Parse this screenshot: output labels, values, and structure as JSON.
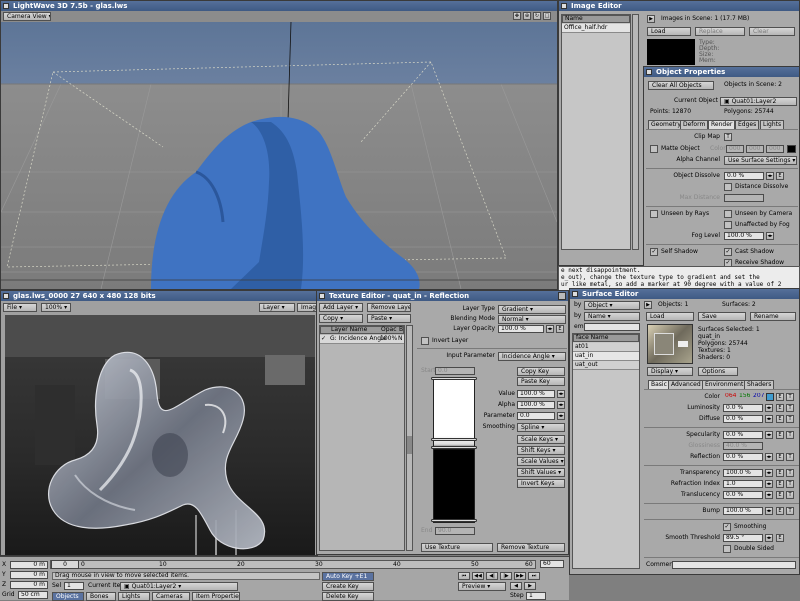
{
  "viewport": {
    "title": "LightWave 3D 7.5b - glas.lws",
    "view_mode": "Camera View"
  },
  "image_editor": {
    "title": "Image Editor",
    "list_header": "Name",
    "items": [
      "Office_half.hdr"
    ],
    "images_in_scene": "Images in Scene: 1 (17.7 MB)",
    "load": "Load",
    "replace": "Replace",
    "clear": "Clear",
    "info": [
      "Type:",
      "Depth:",
      "Size:",
      "Mem:"
    ]
  },
  "object_properties": {
    "title": "Object Properties",
    "clear_all": "Clear All Objects",
    "objects_in_scene": "Objects in Scene: 2",
    "current_object_label": "Current Object",
    "current_object": "Quat01:Layer2",
    "points": "Points: 12870",
    "polygons": "Polygons: 25744",
    "tabs": [
      "Geometry",
      "Deform",
      "Render",
      "Edges",
      "Lights"
    ],
    "clip_map": "Clip Map",
    "matte_object": "Matte Object",
    "color_label": "Color",
    "color_values": [
      "000",
      "000",
      "000"
    ],
    "alpha_channel_label": "Alpha Channel",
    "alpha_channel": "Use Surface Settings",
    "object_dissolve_label": "Object Dissolve",
    "object_dissolve": "0.0 %",
    "distance_dissolve": "Distance Dissolve",
    "max_distance_label": "Max Distance",
    "unseen_by_rays": "Unseen by Rays",
    "unseen_by_camera": "Unseen by Camera",
    "unaffected_by_fog": "Unaffected by Fog",
    "fog_level_label": "Fog Level",
    "fog_level": "100.0 %",
    "self_shadow": "Self Shadow",
    "cast_shadow": "Cast Shadow",
    "receive_shadow": "Receive Shadow"
  },
  "message": {
    "lines": [
      "e next disappointment.",
      "e_out), change the texture type to gradient and set the",
      "ur like metal, so add a marker at 90 degree with a value of 2"
    ]
  },
  "render": {
    "title": "glas.lws_0000 27  640 x 480 128 bits",
    "file": "File",
    "zoom": "100%",
    "layer": "Layer",
    "image": "Image"
  },
  "texture_editor": {
    "title": "Texture Editor - quat_in - Reflection",
    "add_layer": "Add Layer",
    "remove_layer": "Remove Layer",
    "copy": "Copy",
    "paste": "Paste",
    "col_layer_name": "Layer Name",
    "col_opac": "Opac",
    "col_b": "B",
    "row_name": "G: Incidence Angle",
    "row_opac": "100%",
    "row_b": "N",
    "layer_type_label": "Layer Type",
    "layer_type": "Gradient",
    "blending_mode_label": "Blending Mode",
    "blending_mode": "Normal",
    "layer_opacity_label": "Layer Opacity",
    "layer_opacity": "100.0 %",
    "invert_layer": "Invert Layer",
    "input_parameter_label": "Input Parameter",
    "input_parameter": "Incidence Angle",
    "start_label": "Start",
    "start_value": "0.0",
    "end_label": "End",
    "end_value": "90.0",
    "copy_key": "Copy Key",
    "paste_key": "Paste Key",
    "value_label": "Value",
    "value": "100.0 %",
    "alpha_label": "Alpha",
    "alpha": "100.0 %",
    "parameter_label": "Parameter",
    "parameter": "0.0",
    "smoothing_label": "Smoothing",
    "smoothing": "Spline",
    "scale_keys": "Scale Keys",
    "shift_keys": "Shift Keys",
    "scale_values": "Scale Values",
    "shift_values": "Shift Values",
    "invert_keys": "Invert Keys",
    "use_texture": "Use Texture",
    "remove_texture": "Remove Texture"
  },
  "surface_editor": {
    "title": "Surface Editor",
    "by1": "by",
    "object": "Object",
    "by2": "by",
    "name": "Name",
    "filter_label": "em",
    "list_header": "face Name",
    "surfaces": [
      "at01",
      "uat_in",
      "uat_out"
    ],
    "objects_count": "Objects: 1",
    "surfaces_count": "Surfaces: 2",
    "load": "Load",
    "save": "Save",
    "rename": "Rename",
    "info": [
      "Surfaces Selected: 1",
      "quat_in",
      "Polygons: 25744",
      "Textures: 1",
      "Shaders: 0"
    ],
    "display": "Display",
    "options": "Options",
    "tabs": [
      "Basic",
      "Advanced",
      "Environment",
      "Shaders"
    ],
    "color_label": "Color",
    "color_r": "064",
    "color_g": "156",
    "color_b": "207",
    "luminosity_label": "Luminosity",
    "luminosity": "0.0 %",
    "diffuse_label": "Diffuse",
    "diffuse": "0.0 %",
    "specularity_label": "Specularity",
    "specularity": "0.0 %",
    "glossiness_label": "Glossiness",
    "glossiness": "40.0 %",
    "reflection_label": "Reflection",
    "reflection": "0.0 %",
    "transparency_label": "Transparency",
    "transparency": "100.0 %",
    "refraction_label": "Refraction Index",
    "refraction": "1.0",
    "translucency_label": "Translucency",
    "translucency": "0.0 %",
    "bump_label": "Bump",
    "bump": "100.0 %",
    "smoothing": "Smoothing",
    "smooth_threshold_label": "Smooth Threshold",
    "smooth_threshold": "89.5 °",
    "double_sided": "Double Sided",
    "comment_label": "Comment"
  },
  "timeline": {
    "ticks": [
      "0",
      "10",
      "20",
      "30",
      "40",
      "50",
      "60"
    ],
    "current_frame": "0",
    "end_frame": "60",
    "x": "0 m",
    "y": "0 m",
    "z": "0 m",
    "hint": "Drag mouse in view to move selected items.",
    "grid_label": "Grid",
    "grid": "50 cm",
    "sel_label": "Sel",
    "sel": "1",
    "current_item_label": "Current Item",
    "current_item": "Quat01:Layer2",
    "objects": "Objects",
    "bones": "Bones",
    "lights": "Lights",
    "cameras": "Cameras",
    "item_properties": "Item Properties",
    "auto_key": "Auto Key",
    "auto_key_val": "+E1",
    "create_key": "Create Key",
    "delete_key": "Delete Key",
    "preview": "Preview",
    "step_label": "Step",
    "step": "1"
  },
  "colors": {
    "accent": "#4a6594",
    "blue_object": "#3f73c2",
    "surface_swatch": "#409ccf"
  }
}
